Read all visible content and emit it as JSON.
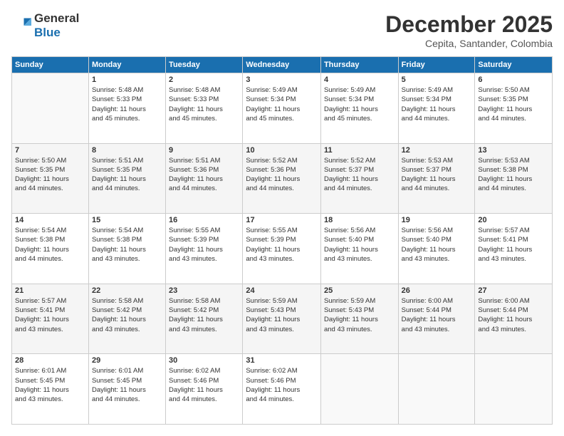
{
  "logo": {
    "line1": "General",
    "line2": "Blue"
  },
  "header": {
    "month": "December 2025",
    "location": "Cepita, Santander, Colombia"
  },
  "days_of_week": [
    "Sunday",
    "Monday",
    "Tuesday",
    "Wednesday",
    "Thursday",
    "Friday",
    "Saturday"
  ],
  "weeks": [
    [
      {
        "day": "",
        "info": ""
      },
      {
        "day": "1",
        "info": "Sunrise: 5:48 AM\nSunset: 5:33 PM\nDaylight: 11 hours\nand 45 minutes."
      },
      {
        "day": "2",
        "info": "Sunrise: 5:48 AM\nSunset: 5:33 PM\nDaylight: 11 hours\nand 45 minutes."
      },
      {
        "day": "3",
        "info": "Sunrise: 5:49 AM\nSunset: 5:34 PM\nDaylight: 11 hours\nand 45 minutes."
      },
      {
        "day": "4",
        "info": "Sunrise: 5:49 AM\nSunset: 5:34 PM\nDaylight: 11 hours\nand 45 minutes."
      },
      {
        "day": "5",
        "info": "Sunrise: 5:49 AM\nSunset: 5:34 PM\nDaylight: 11 hours\nand 44 minutes."
      },
      {
        "day": "6",
        "info": "Sunrise: 5:50 AM\nSunset: 5:35 PM\nDaylight: 11 hours\nand 44 minutes."
      }
    ],
    [
      {
        "day": "7",
        "info": "Sunrise: 5:50 AM\nSunset: 5:35 PM\nDaylight: 11 hours\nand 44 minutes."
      },
      {
        "day": "8",
        "info": "Sunrise: 5:51 AM\nSunset: 5:35 PM\nDaylight: 11 hours\nand 44 minutes."
      },
      {
        "day": "9",
        "info": "Sunrise: 5:51 AM\nSunset: 5:36 PM\nDaylight: 11 hours\nand 44 minutes."
      },
      {
        "day": "10",
        "info": "Sunrise: 5:52 AM\nSunset: 5:36 PM\nDaylight: 11 hours\nand 44 minutes."
      },
      {
        "day": "11",
        "info": "Sunrise: 5:52 AM\nSunset: 5:37 PM\nDaylight: 11 hours\nand 44 minutes."
      },
      {
        "day": "12",
        "info": "Sunrise: 5:53 AM\nSunset: 5:37 PM\nDaylight: 11 hours\nand 44 minutes."
      },
      {
        "day": "13",
        "info": "Sunrise: 5:53 AM\nSunset: 5:38 PM\nDaylight: 11 hours\nand 44 minutes."
      }
    ],
    [
      {
        "day": "14",
        "info": "Sunrise: 5:54 AM\nSunset: 5:38 PM\nDaylight: 11 hours\nand 44 minutes."
      },
      {
        "day": "15",
        "info": "Sunrise: 5:54 AM\nSunset: 5:38 PM\nDaylight: 11 hours\nand 43 minutes."
      },
      {
        "day": "16",
        "info": "Sunrise: 5:55 AM\nSunset: 5:39 PM\nDaylight: 11 hours\nand 43 minutes."
      },
      {
        "day": "17",
        "info": "Sunrise: 5:55 AM\nSunset: 5:39 PM\nDaylight: 11 hours\nand 43 minutes."
      },
      {
        "day": "18",
        "info": "Sunrise: 5:56 AM\nSunset: 5:40 PM\nDaylight: 11 hours\nand 43 minutes."
      },
      {
        "day": "19",
        "info": "Sunrise: 5:56 AM\nSunset: 5:40 PM\nDaylight: 11 hours\nand 43 minutes."
      },
      {
        "day": "20",
        "info": "Sunrise: 5:57 AM\nSunset: 5:41 PM\nDaylight: 11 hours\nand 43 minutes."
      }
    ],
    [
      {
        "day": "21",
        "info": "Sunrise: 5:57 AM\nSunset: 5:41 PM\nDaylight: 11 hours\nand 43 minutes."
      },
      {
        "day": "22",
        "info": "Sunrise: 5:58 AM\nSunset: 5:42 PM\nDaylight: 11 hours\nand 43 minutes."
      },
      {
        "day": "23",
        "info": "Sunrise: 5:58 AM\nSunset: 5:42 PM\nDaylight: 11 hours\nand 43 minutes."
      },
      {
        "day": "24",
        "info": "Sunrise: 5:59 AM\nSunset: 5:43 PM\nDaylight: 11 hours\nand 43 minutes."
      },
      {
        "day": "25",
        "info": "Sunrise: 5:59 AM\nSunset: 5:43 PM\nDaylight: 11 hours\nand 43 minutes."
      },
      {
        "day": "26",
        "info": "Sunrise: 6:00 AM\nSunset: 5:44 PM\nDaylight: 11 hours\nand 43 minutes."
      },
      {
        "day": "27",
        "info": "Sunrise: 6:00 AM\nSunset: 5:44 PM\nDaylight: 11 hours\nand 43 minutes."
      }
    ],
    [
      {
        "day": "28",
        "info": "Sunrise: 6:01 AM\nSunset: 5:45 PM\nDaylight: 11 hours\nand 43 minutes."
      },
      {
        "day": "29",
        "info": "Sunrise: 6:01 AM\nSunset: 5:45 PM\nDaylight: 11 hours\nand 44 minutes."
      },
      {
        "day": "30",
        "info": "Sunrise: 6:02 AM\nSunset: 5:46 PM\nDaylight: 11 hours\nand 44 minutes."
      },
      {
        "day": "31",
        "info": "Sunrise: 6:02 AM\nSunset: 5:46 PM\nDaylight: 11 hours\nand 44 minutes."
      },
      {
        "day": "",
        "info": ""
      },
      {
        "day": "",
        "info": ""
      },
      {
        "day": "",
        "info": ""
      }
    ]
  ]
}
